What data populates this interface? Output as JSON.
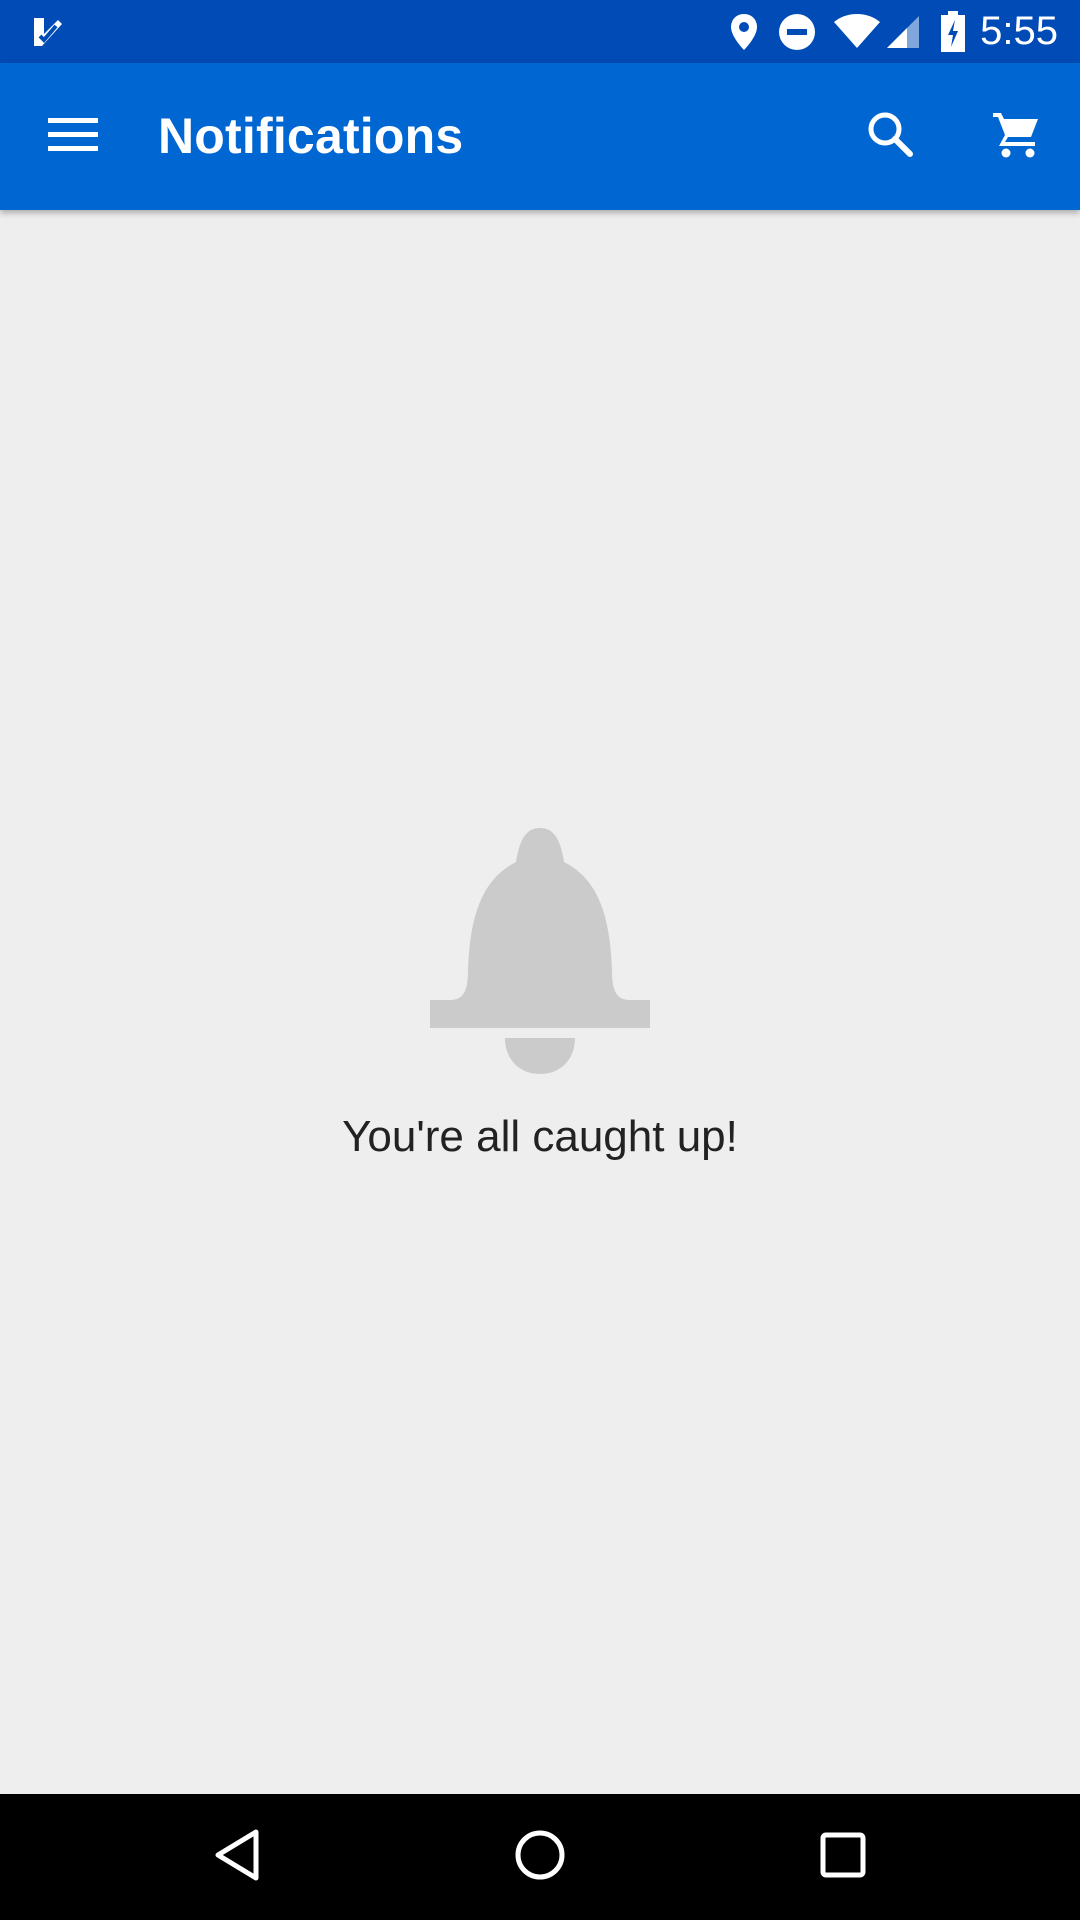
{
  "status_bar": {
    "time": "5:55",
    "icons": [
      "app-notification-icon",
      "location-icon",
      "do-not-disturb-icon",
      "wifi-icon",
      "cellular-signal-icon",
      "battery-charging-icon"
    ]
  },
  "app_bar": {
    "title": "Notifications",
    "icons": [
      "menu-icon",
      "search-icon",
      "cart-icon"
    ]
  },
  "empty_state": {
    "icon": "bell-icon",
    "message": "You're all caught up!"
  },
  "nav_bar": {
    "icons": [
      "back-icon",
      "home-icon",
      "recents-icon"
    ]
  },
  "colors": {
    "status_bar": "#004bb5",
    "app_bar": "#0066d2",
    "background": "#eeeeee",
    "bell": "#cbcbcb",
    "nav_bar": "#000000"
  }
}
